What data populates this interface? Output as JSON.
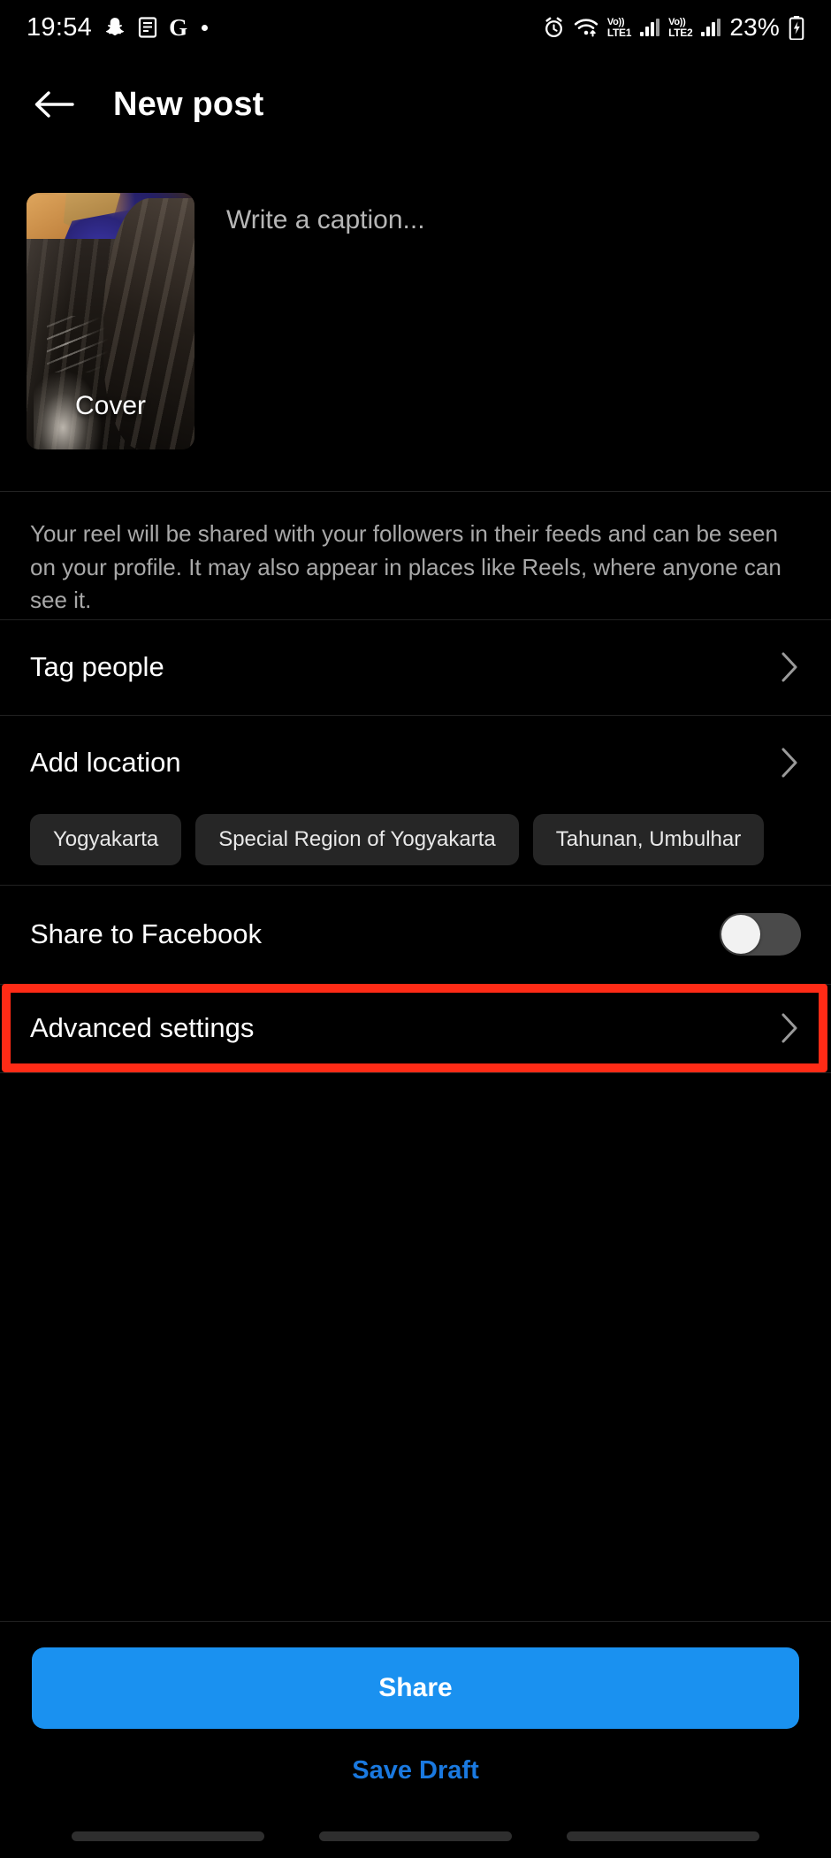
{
  "statusbar": {
    "time": "19:54",
    "battery_percent": "23%",
    "icons": {
      "snapchat": "snapchat-ghost-icon",
      "message": "message-icon",
      "google": "G",
      "dot": "dot-indicator-icon",
      "alarm": "alarm-clock-icon",
      "wifi": "wifi-icon",
      "battery": "battery-charging-icon"
    },
    "sim1_label_top": "Vo))",
    "sim1_label_bottom": "LTE1",
    "sim2_label_top": "Vo))",
    "sim2_label_bottom": "LTE2"
  },
  "header": {
    "title": "New post",
    "back_icon": "arrow-left-icon"
  },
  "composer": {
    "cover_label": "Cover",
    "caption_placeholder": "Write a caption..."
  },
  "info": {
    "text": "Your reel will be shared with your followers in their feeds and can be seen on your profile. It may also appear in places like Reels, where anyone can see it."
  },
  "rows": {
    "tag_people": "Tag people",
    "add_location": "Add location",
    "share_to_facebook": "Share to Facebook",
    "advanced_settings": "Advanced settings"
  },
  "location_chips": [
    {
      "label": "Yogyakarta"
    },
    {
      "label": "Special Region of Yogyakarta"
    },
    {
      "label": "Tahunan, Umbulhar"
    }
  ],
  "toggles": {
    "facebook_state": "off"
  },
  "footer": {
    "share_label": "Share",
    "save_draft_label": "Save Draft"
  },
  "colors": {
    "accent_blue": "#1A91F0",
    "link_blue": "#1A79E0",
    "highlight_red": "#FF2B16",
    "chip_bg": "#262626",
    "background": "#000000"
  }
}
